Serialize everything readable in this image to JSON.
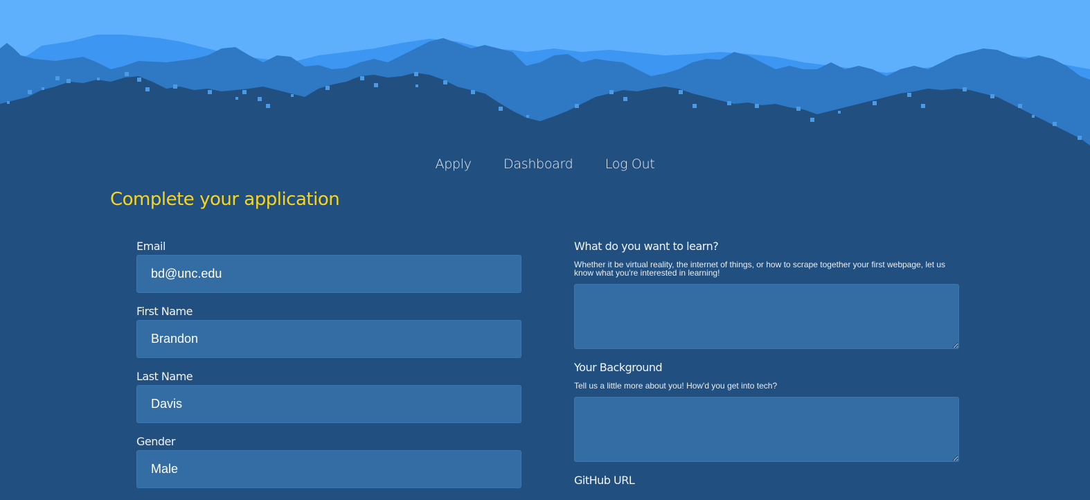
{
  "nav": {
    "items": [
      "Apply",
      "Dashboard",
      "Log Out"
    ]
  },
  "page": {
    "title": "Complete your application"
  },
  "form_left": {
    "email": {
      "label": "Email",
      "value": "bd@unc.edu"
    },
    "first_name": {
      "label": "First Name",
      "value": "Brandon"
    },
    "last_name": {
      "label": "Last Name",
      "value": "Davis"
    },
    "gender": {
      "label": "Gender",
      "value": "Male"
    }
  },
  "form_right": {
    "learn": {
      "label": "What do you want to learn?",
      "help": "Whether it be virtual reality, the internet of things, or how to scrape together your first webpage, let us know what you're interested in learning!",
      "value": ""
    },
    "background": {
      "label": "Your Background",
      "help": "Tell us a little more about you! How'd you get into tech?",
      "value": ""
    },
    "github": {
      "label": "GitHub URL"
    }
  },
  "colors": {
    "page_bg": "#214f7f",
    "sky": "#5eb0fc",
    "title": "#f7d51d",
    "input_bg": "#346ca4"
  }
}
